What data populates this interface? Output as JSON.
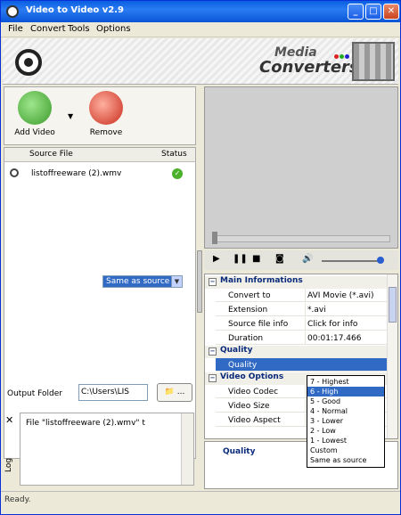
{
  "window": {
    "title": "Video to Video v2.9"
  },
  "menu": [
    "File",
    "Convert",
    "Tools",
    "Options"
  ],
  "banner": {
    "logo_line1": "Media",
    "logo_line2": "Converters"
  },
  "toolbar": {
    "add_label": "Add Video",
    "remove_label": "Remove"
  },
  "file_list": {
    "columns": [
      "Source File",
      "Status"
    ],
    "rows": [
      {
        "name": "listoffreeware (2).wmv",
        "status": "ok"
      }
    ]
  },
  "output_folder": {
    "label": "Output Folder",
    "value": "C:\\Users\\LIS",
    "browse_label": "..."
  },
  "log": {
    "label": "Log",
    "text": "File \"listoffreeware (2).wmv\" t"
  },
  "properties": {
    "groups": [
      {
        "name": "Main Informations",
        "rows": [
          {
            "key": "Convert to",
            "value": "AVI Movie (*.avi)"
          },
          {
            "key": "Extension",
            "value": "*.avi"
          },
          {
            "key": "Source file info",
            "value": "Click for info"
          },
          {
            "key": "Duration",
            "value": "00:01:17.466"
          }
        ]
      },
      {
        "name": "Quality",
        "rows": [
          {
            "key": "Quality",
            "value": "Same as source"
          }
        ]
      },
      {
        "name": "Video Options",
        "rows": [
          {
            "key": "Video Codec",
            "value": ""
          },
          {
            "key": "Video Size",
            "value": ""
          },
          {
            "key": "Video Aspect",
            "value": ""
          }
        ]
      }
    ]
  },
  "quality_dropdown": {
    "selected": "Same as source",
    "options": [
      "7 - Highest",
      "6 - High",
      "5 - Good",
      "4 - Normal",
      "3 - Lower",
      "2 - Low",
      "1 - Lowest",
      "Custom",
      "Same as source"
    ],
    "highlighted": "6 - High"
  },
  "description": {
    "title": "Quality"
  },
  "status": {
    "text": "Ready."
  }
}
